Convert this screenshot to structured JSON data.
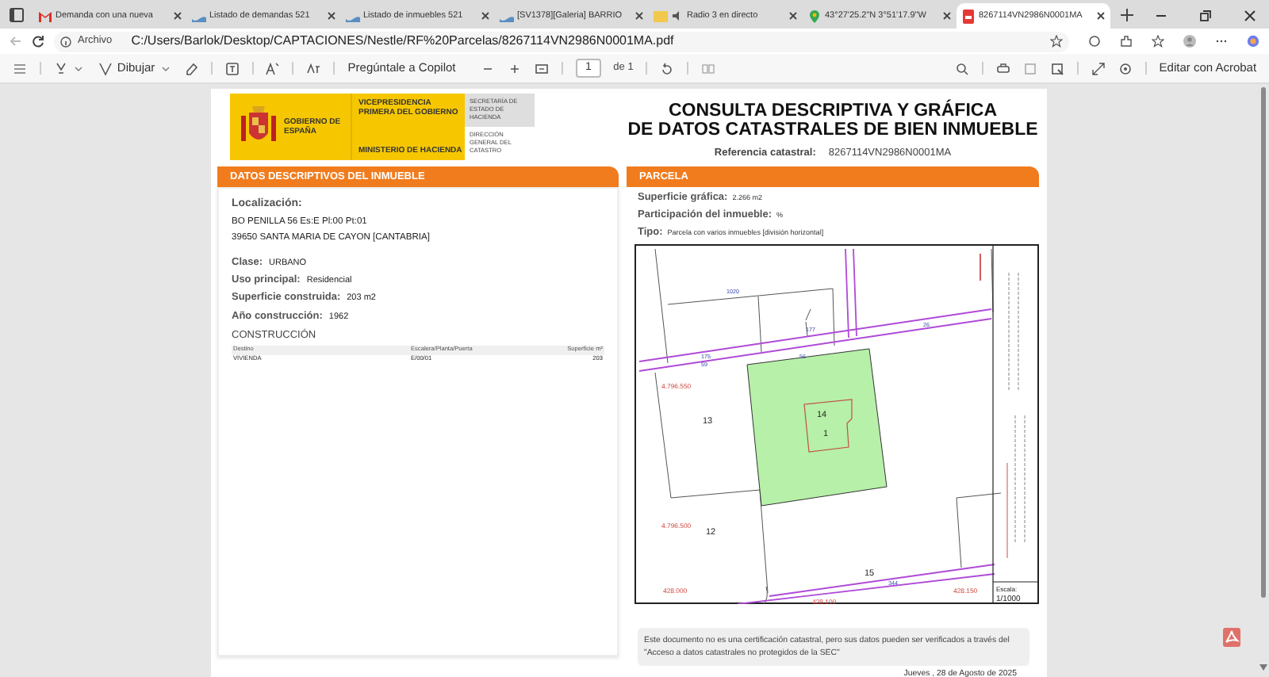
{
  "browser": {
    "tabs": [
      {
        "kind": "mail",
        "title": "Demanda con una nueva",
        "selected": false
      },
      {
        "kind": "listing",
        "title": "Listado de demandas 521",
        "selected": false
      },
      {
        "kind": "listing",
        "title": "Listado de inmuebles 521",
        "selected": false
      },
      {
        "kind": "listing",
        "title": "[SV1378][Galeria] BARRIO",
        "selected": false
      },
      {
        "kind": "radio",
        "title": "Radio 3 en directo",
        "selected": false
      },
      {
        "kind": "maps",
        "title": "43°27'25.2\"N 3°51'17.9\"W",
        "selected": false
      },
      {
        "kind": "pdf",
        "title": "8267114VN2986N0001MA",
        "selected": true
      }
    ],
    "address": {
      "label": "Archivo",
      "url": "C:/Users/Barlok/Desktop/CAPTACIONES/Nestle/RF%20Parcelas/8267114VN2986N0001MA.pdf"
    }
  },
  "pdf_toolbar": {
    "draw": "Dibujar",
    "copilot": "Pregúntale a Copilot",
    "page": "1",
    "page_total": "de 1",
    "edit": "Editar con Acrobat"
  },
  "document": {
    "header": {
      "crest_text": "GOBIERNO DE ESPAÑA",
      "vice": "VICEPRESIDENCIA PRIMERA DEL GOBIERNO",
      "ministry": "MINISTERIO DE HACIENDA",
      "secretariat": "SECRETARÍA DE ESTADO DE HACIENDA",
      "direction": "DIRECCIÓN GENERAL DEL CATASTRO"
    },
    "title_lines": [
      "CONSULTA DESCRIPTIVA Y GRÁFICA",
      "DE DATOS CATASTRALES DE BIEN INMUEBLE"
    ],
    "reference": {
      "label": "Referencia catastral:",
      "value": "8267114VN2986N0001MA"
    },
    "property": {
      "heading": "DATOS DESCRIPTIVOS DEL INMUEBLE",
      "location_label": "Localización:",
      "address_lines": [
        "BO PENILLA 56 Es:E Pl:00 Pt:01",
        "39650 SANTA MARIA DE CAYON [CANTABRIA]"
      ],
      "fields": [
        {
          "label": "Clase:",
          "value": "URBANO"
        },
        {
          "label": "Uso principal:",
          "value": "Residencial"
        },
        {
          "label": "Superficie construida:",
          "value": "203 m2"
        },
        {
          "label": "Año construcción:",
          "value": "1962"
        }
      ],
      "construction": {
        "heading": "CONSTRUCCIÓN",
        "columns": [
          "Destino",
          "Escalera/Planta/Puerta",
          "Superficie m²"
        ],
        "rows": [
          [
            "VIVIENDA",
            "E/00/01",
            "203"
          ]
        ]
      }
    },
    "parcel": {
      "heading": "PARCELA",
      "fields": [
        {
          "label": "Superficie gráfica:",
          "value": "2.266 m2"
        },
        {
          "label": "Participación del inmueble:",
          "value": "%"
        },
        {
          "label": "Tipo:",
          "value": "Parcela con varios inmuebles [división horizontal]"
        }
      ],
      "map": {
        "labels": [
          "1020",
          "175",
          "59",
          "177",
          "56",
          "26",
          "4.796.550",
          "13",
          "14",
          "1",
          "12",
          "4.796.500",
          "15",
          "344",
          "428.000",
          "428.100",
          "428.150"
        ],
        "scale_label": "Escala:",
        "scale": "1/1000"
      }
    },
    "note": "Este documento no es una certificación catastral, pero sus datos pueden ser verificados a través del \"Acceso a datos catastrales no protegidos de la SEC\"",
    "date": "Jueves , 28 de Agosto de 2025"
  }
}
